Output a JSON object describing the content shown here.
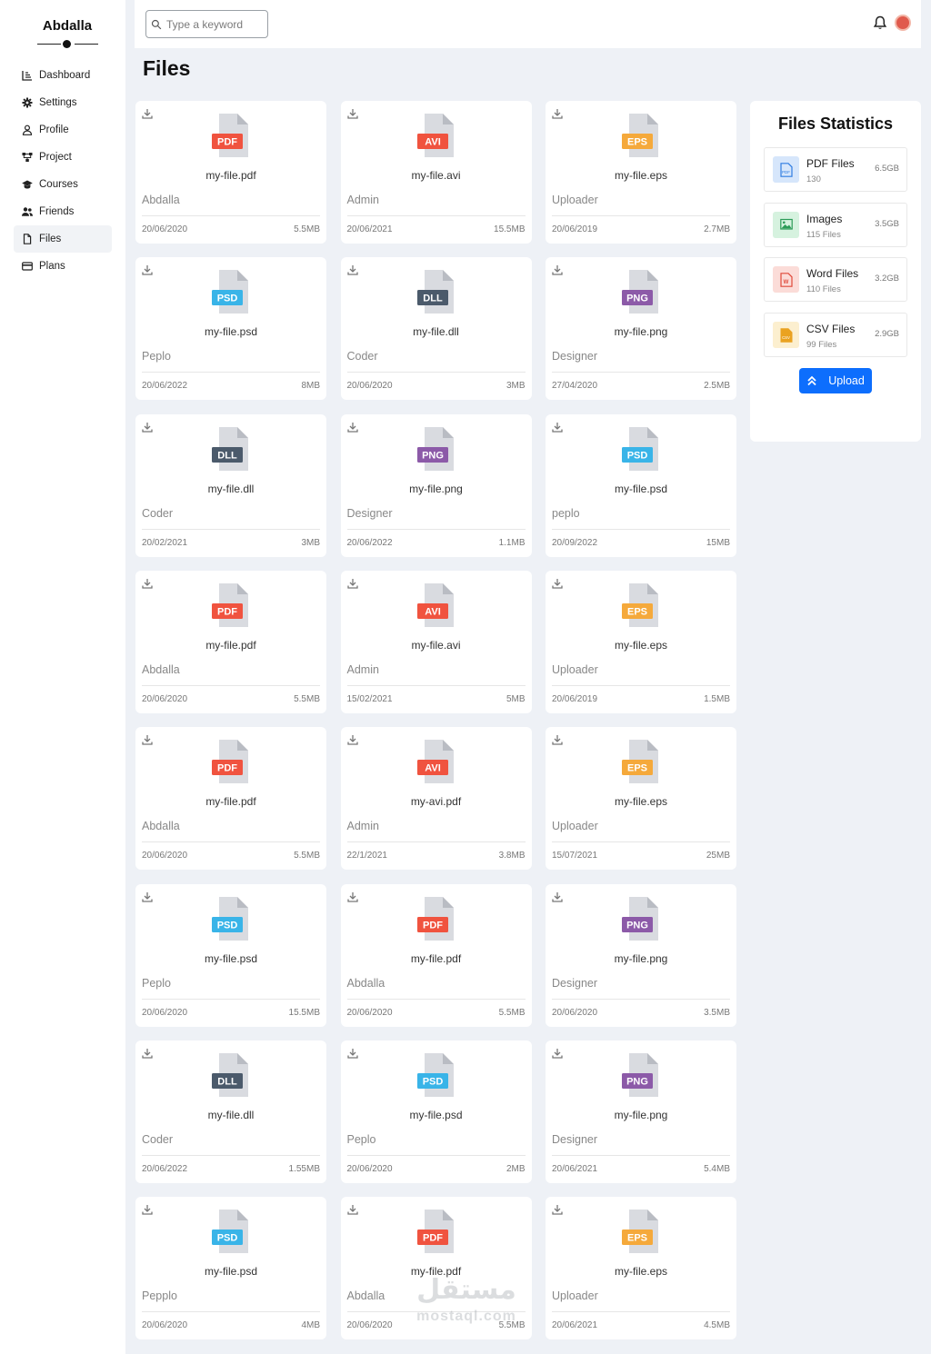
{
  "brand": {
    "name": "Abdalla"
  },
  "sidebar": {
    "items": [
      {
        "label": "Dashboard",
        "icon": "chart-icon",
        "active": false
      },
      {
        "label": "Settings",
        "icon": "gear-icon",
        "active": false
      },
      {
        "label": "Profile",
        "icon": "user-icon",
        "active": false
      },
      {
        "label": "Project",
        "icon": "project-icon",
        "active": false
      },
      {
        "label": "Courses",
        "icon": "graduation-cap-icon",
        "active": false
      },
      {
        "label": "Friends",
        "icon": "users-icon",
        "active": false
      },
      {
        "label": "Files",
        "icon": "file-icon",
        "active": true
      },
      {
        "label": "Plans",
        "icon": "credit-card-icon",
        "active": false
      }
    ]
  },
  "header": {
    "search_placeholder": "Type a keyword",
    "bell_icon": "bell-icon",
    "avatar_icon": "avatar-icon"
  },
  "page": {
    "title": "Files"
  },
  "type_colors": {
    "PDF": "#f0533f",
    "AVI": "#f0533f",
    "EPS": "#f5a93b",
    "PSD": "#39b4e8",
    "DLL": "#4b5a6b",
    "PNG": "#8c5aa8"
  },
  "files": [
    {
      "type": "PDF",
      "name": "my-file.pdf",
      "owner": "Abdalla",
      "date": "20/06/2020",
      "size": "5.5MB"
    },
    {
      "type": "AVI",
      "name": "my-file.avi",
      "owner": "Admin",
      "date": "20/06/2021",
      "size": "15.5MB"
    },
    {
      "type": "EPS",
      "name": "my-file.eps",
      "owner": "Uploader",
      "date": "20/06/2019",
      "size": "2.7MB"
    },
    {
      "type": "PSD",
      "name": "my-file.psd",
      "owner": "Peplo",
      "date": "20/06/2022",
      "size": "8MB"
    },
    {
      "type": "DLL",
      "name": "my-file.dll",
      "owner": "Coder",
      "date": "20/06/2020",
      "size": "3MB"
    },
    {
      "type": "PNG",
      "name": "my-file.png",
      "owner": "Designer",
      "date": "27/04/2020",
      "size": "2.5MB"
    },
    {
      "type": "DLL",
      "name": "my-file.dll",
      "owner": "Coder",
      "date": "20/02/2021",
      "size": "3MB"
    },
    {
      "type": "PNG",
      "name": "my-file.png",
      "owner": "Designer",
      "date": "20/06/2022",
      "size": "1.1MB"
    },
    {
      "type": "PSD",
      "name": "my-file.psd",
      "owner": "peplo",
      "date": "20/09/2022",
      "size": "15MB"
    },
    {
      "type": "PDF",
      "name": "my-file.pdf",
      "owner": "Abdalla",
      "date": "20/06/2020",
      "size": "5.5MB"
    },
    {
      "type": "AVI",
      "name": "my-file.avi",
      "owner": "Admin",
      "date": "15/02/2021",
      "size": "5MB"
    },
    {
      "type": "EPS",
      "name": "my-file.eps",
      "owner": "Uploader",
      "date": "20/06/2019",
      "size": "1.5MB"
    },
    {
      "type": "PDF",
      "name": "my-file.pdf",
      "owner": "Abdalla",
      "date": "20/06/2020",
      "size": "5.5MB"
    },
    {
      "type": "AVI",
      "name": "my-avi.pdf",
      "owner": "Admin",
      "date": "22/1/2021",
      "size": "3.8MB"
    },
    {
      "type": "EPS",
      "name": "my-file.eps",
      "owner": "Uploader",
      "date": "15/07/2021",
      "size": "25MB"
    },
    {
      "type": "PSD",
      "name": "my-file.psd",
      "owner": "Peplo",
      "date": "20/06/2020",
      "size": "15.5MB"
    },
    {
      "type": "PDF",
      "name": "my-file.pdf",
      "owner": "Abdalla",
      "date": "20/06/2020",
      "size": "5.5MB"
    },
    {
      "type": "PNG",
      "name": "my-file.png",
      "owner": "Designer",
      "date": "20/06/2020",
      "size": "3.5MB"
    },
    {
      "type": "DLL",
      "name": "my-file.dll",
      "owner": "Coder",
      "date": "20/06/2022",
      "size": "1.55MB"
    },
    {
      "type": "PSD",
      "name": "my-file.psd",
      "owner": "Peplo",
      "date": "20/06/2020",
      "size": "2MB"
    },
    {
      "type": "PNG",
      "name": "my-file.png",
      "owner": "Designer",
      "date": "20/06/2021",
      "size": "5.4MB"
    },
    {
      "type": "PSD",
      "name": "my-file.psd",
      "owner": "Pepplo",
      "date": "20/06/2020",
      "size": "4MB"
    },
    {
      "type": "PDF",
      "name": "my-file.pdf",
      "owner": "Abdalla",
      "date": "20/06/2020",
      "size": "5.5MB"
    },
    {
      "type": "EPS",
      "name": "my-file.eps",
      "owner": "Uploader",
      "date": "20/06/2021",
      "size": "4.5MB"
    }
  ],
  "stats": {
    "title": "Files Statistics",
    "items": [
      {
        "name": "PDF Files",
        "count": "130",
        "size": "6.5GB",
        "icon": "pdf-file-icon",
        "bg": "#d6e6fb",
        "fg": "#2f7de1"
      },
      {
        "name": "Images",
        "count": "115 Files",
        "size": "3.5GB",
        "icon": "image-icon",
        "bg": "#d6f2df",
        "fg": "#2c9b58"
      },
      {
        "name": "Word Files",
        "count": "110 Files",
        "size": "3.2GB",
        "icon": "word-file-icon",
        "bg": "#fbdcd8",
        "fg": "#e0493a"
      },
      {
        "name": "CSV Files",
        "count": "99 Files",
        "size": "2.9GB",
        "icon": "csv-file-icon",
        "bg": "#fcefcf",
        "fg": "#eaa220"
      }
    ],
    "upload_label": "Upload",
    "upload_color": "#0d6efd"
  },
  "watermark": {
    "arabic": "مستقل",
    "latin": "mostaql.com"
  }
}
